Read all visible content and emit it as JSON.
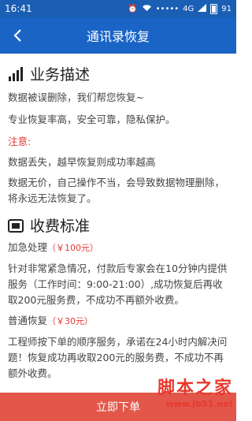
{
  "status_bar": {
    "time": "16:41",
    "network": "4G",
    "battery": "91"
  },
  "nav": {
    "title": "通讯录恢复"
  },
  "description": {
    "title": "业务描述",
    "lines": [
      "数据被误删除，我们帮您恢复~",
      "专业恢复率高，安全可靠，隐私保护。"
    ],
    "note_label": "注意:",
    "note_lines": [
      "数据丢失，越早恢复则成功率越高",
      "数据无价，自己操作不当，会导致数据物理删除，将永远无法恢复了。"
    ]
  },
  "pricing": {
    "title": "收费标准",
    "urgent": {
      "label": "加急处理",
      "price": "（￥100元）",
      "desc": "针对非常紧急情况，付款后专家会在10分钟内提供服务（工作时间：9:00-21:00）,成功恢复后再收取200元服务费，不成功不再额外收费。"
    },
    "normal": {
      "label": "普通恢复",
      "price": "（￥30元）",
      "desc": "工程师按下单的顺序服务，承诺在24小时内解决问题！恢复成功再收取200元的服务费，不成功不再额外收费。"
    }
  },
  "submit": {
    "label": "立即下单"
  },
  "watermark": {
    "title": "脚本之家",
    "url": "www.jb51.net"
  }
}
